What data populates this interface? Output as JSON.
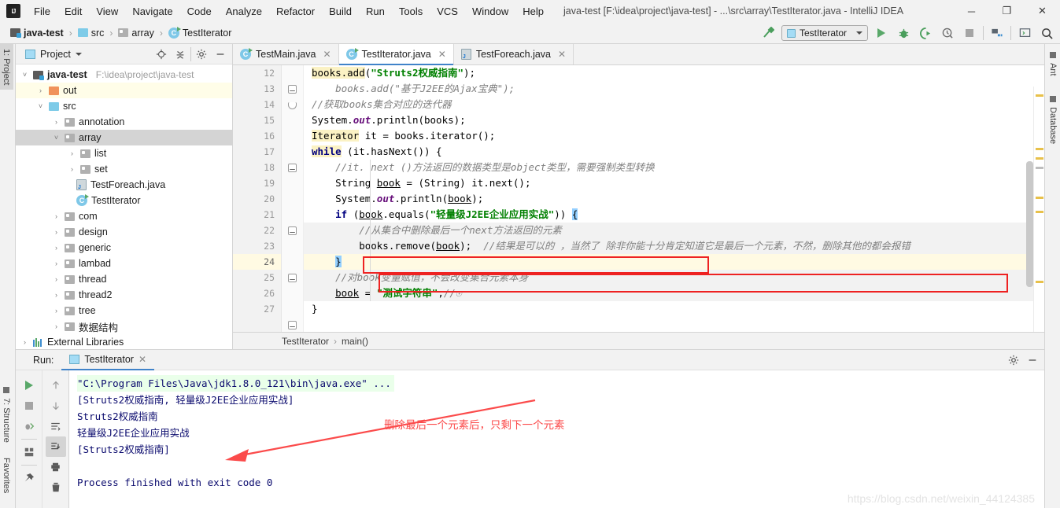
{
  "window": {
    "title": "java-test [F:\\idea\\project\\java-test] - ...\\src\\array\\TestIterator.java - IntelliJ IDEA",
    "logo": "IJ",
    "minimize": "─",
    "maximize": "❐",
    "close": "✕"
  },
  "menubar": {
    "items": [
      {
        "label": "File"
      },
      {
        "label": "Edit"
      },
      {
        "label": "View"
      },
      {
        "label": "Navigate"
      },
      {
        "label": "Code"
      },
      {
        "label": "Analyze"
      },
      {
        "label": "Refactor"
      },
      {
        "label": "Build"
      },
      {
        "label": "Run"
      },
      {
        "label": "Tools"
      },
      {
        "label": "VCS"
      },
      {
        "label": "Window"
      },
      {
        "label": "Help"
      }
    ]
  },
  "breadcrumbs": {
    "items": [
      {
        "label": "java-test",
        "icon": "project-folder-icon"
      },
      {
        "label": "src",
        "icon": "source-folder-icon"
      },
      {
        "label": "array",
        "icon": "package-folder-icon"
      },
      {
        "label": "TestIterator",
        "icon": "java-class-icon"
      }
    ],
    "separator": "›"
  },
  "toolbar": {
    "build_icon": "hammer-icon",
    "run_config": "TestIterator",
    "run_icon": "run-icon",
    "debug_icon": "debug-icon",
    "run_coverage_icon": "run-with-coverage-icon",
    "profile_icon": "profiler-icon",
    "stop_icon": "stop-icon",
    "project_structure_icon": "project-structure-icon",
    "open_terminal_icon": "terminal-icon",
    "search_icon": "search-everywhere-icon"
  },
  "left_rail": {
    "tabs": [
      {
        "label": "1: Project",
        "active": true
      },
      {
        "label": "7: Structure",
        "active": false
      },
      {
        "label": "Favorites",
        "active": false
      }
    ]
  },
  "right_rail": {
    "tabs": [
      {
        "label": "Ant",
        "active": false
      },
      {
        "label": "Database",
        "active": false
      }
    ]
  },
  "project_panel": {
    "title": "Project",
    "tools": [
      "locate-icon",
      "collapse-all-icon",
      "settings-gear-icon",
      "hide-icon"
    ],
    "tree": [
      {
        "label": "java-test",
        "sub": "F:\\idea\\project\\java-test",
        "depth": 0,
        "arrow": "˅",
        "icon": "project-folder-icon",
        "bold": true,
        "state": "none"
      },
      {
        "label": "out",
        "sub": "",
        "depth": 1,
        "arrow": "›",
        "icon": "orange-folder-icon",
        "bold": false,
        "state": "highlight"
      },
      {
        "label": "src",
        "sub": "",
        "depth": 1,
        "arrow": "˅",
        "icon": "source-folder-icon",
        "bold": false,
        "state": "none"
      },
      {
        "label": "annotation",
        "sub": "",
        "depth": 2,
        "arrow": "›",
        "icon": "package-folder-icon",
        "bold": false,
        "state": "none"
      },
      {
        "label": "array",
        "sub": "",
        "depth": 2,
        "arrow": "˅",
        "icon": "package-folder-icon",
        "bold": false,
        "state": "selected"
      },
      {
        "label": "list",
        "sub": "",
        "depth": 3,
        "arrow": "›",
        "icon": "package-folder-icon",
        "bold": false,
        "state": "none"
      },
      {
        "label": "set",
        "sub": "",
        "depth": 3,
        "arrow": "›",
        "icon": "package-folder-icon",
        "bold": false,
        "state": "none"
      },
      {
        "label": "TestForeach.java",
        "sub": "",
        "depth": 3,
        "arrow": "",
        "icon": "java-file-icon",
        "bold": false,
        "state": "none"
      },
      {
        "label": "TestIterator",
        "sub": "",
        "depth": 3,
        "arrow": "",
        "icon": "java-class-icon",
        "bold": false,
        "state": "none"
      },
      {
        "label": "com",
        "sub": "",
        "depth": 2,
        "arrow": "›",
        "icon": "package-folder-icon",
        "bold": false,
        "state": "none"
      },
      {
        "label": "design",
        "sub": "",
        "depth": 2,
        "arrow": "›",
        "icon": "package-folder-icon",
        "bold": false,
        "state": "none"
      },
      {
        "label": "generic",
        "sub": "",
        "depth": 2,
        "arrow": "›",
        "icon": "package-folder-icon",
        "bold": false,
        "state": "none"
      },
      {
        "label": "lambad",
        "sub": "",
        "depth": 2,
        "arrow": "›",
        "icon": "package-folder-icon",
        "bold": false,
        "state": "none"
      },
      {
        "label": "thread",
        "sub": "",
        "depth": 2,
        "arrow": "›",
        "icon": "package-folder-icon",
        "bold": false,
        "state": "none"
      },
      {
        "label": "thread2",
        "sub": "",
        "depth": 2,
        "arrow": "›",
        "icon": "package-folder-icon",
        "bold": false,
        "state": "none"
      },
      {
        "label": "tree",
        "sub": "",
        "depth": 2,
        "arrow": "›",
        "icon": "package-folder-icon",
        "bold": false,
        "state": "none"
      },
      {
        "label": "数据结构",
        "sub": "",
        "depth": 2,
        "arrow": "›",
        "icon": "package-folder-icon",
        "bold": false,
        "state": "none"
      },
      {
        "label": "External Libraries",
        "sub": "",
        "depth": 0,
        "arrow": "›",
        "icon": "libraries-icon",
        "bold": false,
        "state": "none"
      }
    ]
  },
  "editor": {
    "tabs": [
      {
        "label": "TestMain.java",
        "icon": "java-class-icon",
        "active": false
      },
      {
        "label": "TestIterator.java",
        "icon": "java-class-icon",
        "active": true
      },
      {
        "label": "TestForeach.java",
        "icon": "java-file-icon",
        "active": false
      }
    ],
    "lines": [
      {
        "num": "12",
        "text": "books.add(\"Struts2权威指南\");"
      },
      {
        "num": "13",
        "text": "    books.add(\"基于J2EE的Ajax宝典\");"
      },
      {
        "num": "14",
        "text": "//获取books集合对应的迭代器"
      },
      {
        "num": "15",
        "text": "System.out.println(books);"
      },
      {
        "num": "16",
        "text": "Iterator it = books.iterator();"
      },
      {
        "num": "17",
        "text": "while (it.hasNext()) {"
      },
      {
        "num": "18",
        "text": "    //it. next ()方法返回的数据类型是object类型，需要强制类型转换"
      },
      {
        "num": "19",
        "text": "    String book = (String) it.next();"
      },
      {
        "num": "20",
        "text": "    System.out.println(book);"
      },
      {
        "num": "21",
        "text": "    if (book.equals(\"轻量级J2EE企业应用实战\")) {"
      },
      {
        "num": "22",
        "text": "        //从集合中删除最后一个next方法返回的元素"
      },
      {
        "num": "23",
        "text": "        books.remove(book);  //结果是可以的 ，当然了 除非你能十分肯定知道它是最后一个元素，不然，删除其他的都会报错"
      },
      {
        "num": "24",
        "text": "    }"
      },
      {
        "num": "25",
        "text": "    //对book变量赋值，不会改变集合元素本身"
      },
      {
        "num": "26",
        "text": "    book = \"测试字符串\";//⊙"
      },
      {
        "num": "27",
        "text": "}"
      }
    ],
    "comment_prefix_13": "//",
    "breadcrumb": {
      "class": "TestIterator",
      "method": "main()",
      "sep": "›"
    }
  },
  "run_panel": {
    "label": "Run:",
    "tab": "TestIterator",
    "close": "✕",
    "left_buttons": [
      "rerun-icon",
      "stop-icon",
      "rerun-failed-tests-icon",
      "layout-icon",
      "pin-tab-icon"
    ],
    "right_buttons": [
      "scroll-up-icon",
      "scroll-down-icon",
      "soft-wrap-icon",
      "scroll-to-end-icon",
      "print-icon",
      "clear-all-icon"
    ],
    "header_tools": [
      "settings-gear-icon",
      "hide-icon"
    ],
    "console": [
      {
        "text": "\"C:\\Program Files\\Java\\jdk1.8.0_121\\bin\\java.exe\" ...",
        "type": "cmd"
      },
      {
        "text": "[Struts2权威指南, 轻量级J2EE企业应用实战]",
        "type": "out"
      },
      {
        "text": "Struts2权威指南",
        "type": "out"
      },
      {
        "text": "轻量级J2EE企业应用实战",
        "type": "out"
      },
      {
        "text": "[Struts2权威指南]",
        "type": "out"
      },
      {
        "text": "",
        "type": "blank"
      },
      {
        "text": "Process finished with exit code 0",
        "type": "out"
      }
    ]
  },
  "annotations": {
    "console_note": "删除最后一个元素后，只剩下一个元素",
    "accent_red": "#fb4b4b",
    "box_red": "#ee2222"
  },
  "watermark": "https://blog.csdn.net/weixin_44124385"
}
